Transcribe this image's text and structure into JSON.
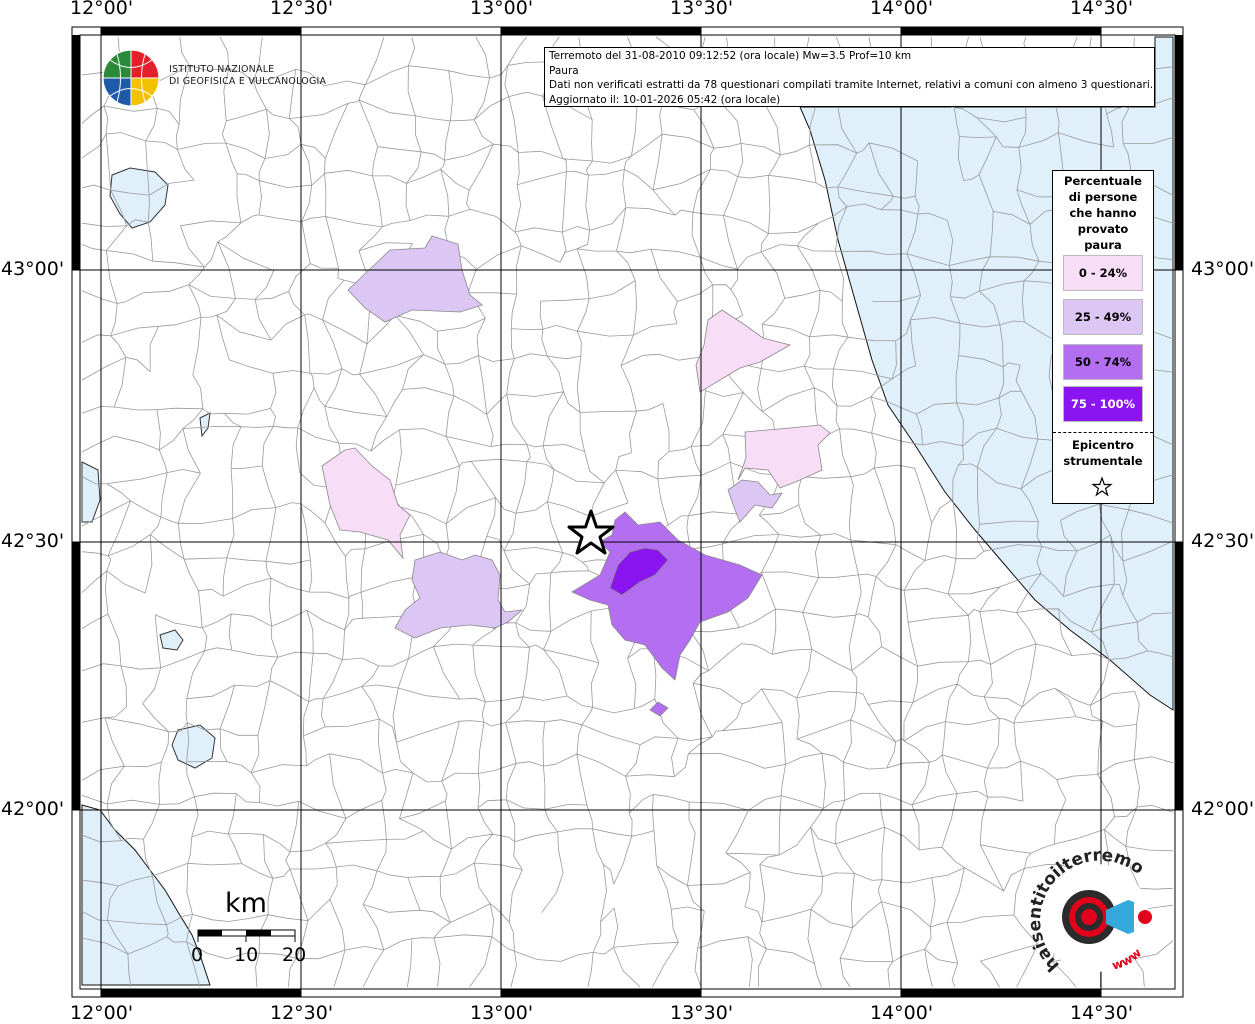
{
  "map": {
    "info_lines": [
      "Terremoto del 31-08-2010 09:12:52 (ora locale) Mw=3.5 Prof=10 km",
      "Paura",
      "Dati non verificati estratti da 78 questionari compilati tramite Internet, relativi a comuni con almeno 3 questionari.",
      "Aggiornato il: 10-01-2026 05:42 (ora locale)"
    ],
    "lon_ticks": [
      "12°00'",
      "12°30'",
      "13°00'",
      "13°30'",
      "14°00'",
      "14°30'"
    ],
    "lat_ticks": [
      "43°00'",
      "42°30'",
      "42°00'"
    ]
  },
  "legend": {
    "title": "Percentuale di persone che hanno provato paura",
    "title_lines": [
      "Percentuale",
      "di persone",
      "che hanno",
      "provato",
      "paura"
    ],
    "classes": [
      {
        "label": "0 - 24%",
        "color": "#f8ddf6",
        "text_color": "#000000"
      },
      {
        "label": "25 - 49%",
        "color": "#dcc6f4",
        "text_color": "#000000"
      },
      {
        "label": "50 - 74%",
        "color": "#b46ef2",
        "text_color": "#000000"
      },
      {
        "label": "75 - 100%",
        "color": "#8a15f0",
        "text_color": "#ffffff"
      }
    ],
    "epicenter_lines": [
      "Epicentro",
      "strumentale"
    ]
  },
  "logo": {
    "line1": "ISTITUTO NAZIONALE",
    "line2": "DI GEOFISICA E VULCANOLOGIA"
  },
  "scale": {
    "title": "km",
    "labels": [
      "0",
      "10",
      "20"
    ]
  },
  "badge": {
    "text": "haisentitoilterremoto.it",
    "url_text": "www"
  },
  "colors": {
    "sea": "#dff0fb",
    "border": "#9a9a9a",
    "grid": "#000000",
    "accent_red": "#e3001b"
  }
}
